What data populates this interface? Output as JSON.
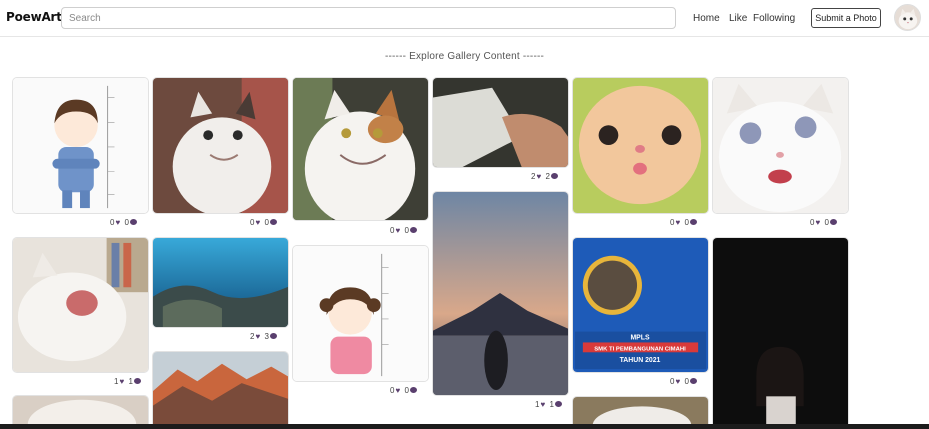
{
  "nav": {
    "brand": "PoewArt.",
    "search_placeholder": "Search",
    "links": {
      "home": "Home",
      "like": "Like",
      "following": "Following"
    },
    "submit_label": "Submit a Photo"
  },
  "gallery": {
    "title": "------ Explore Gallery Content ------",
    "items": [
      {
        "likes": "0",
        "comments": "0"
      },
      {
        "likes": "0",
        "comments": "0"
      },
      {
        "likes": "0",
        "comments": "0"
      },
      {
        "likes": "2",
        "comments": "2"
      },
      {
        "likes": "0",
        "comments": "0"
      },
      {
        "likes": "0",
        "comments": "0"
      },
      {
        "likes": "1",
        "comments": "1"
      },
      {
        "likes": "2",
        "comments": "3"
      },
      {
        "likes": "0",
        "comments": "0"
      },
      {
        "likes": "1",
        "comments": "1"
      },
      {
        "likes": "0",
        "comments": "0"
      }
    ],
    "banner": {
      "line1": "MPLS",
      "line2": "SMK TI PEMBANGUNAN CIMAHI",
      "line3": "TAHUN 2021"
    }
  },
  "icons": {
    "heart": "heart-icon",
    "comment": "comment-icon"
  },
  "colors": {
    "icon": "#5a3f6e",
    "border": "#e2e2e2",
    "banner_blue": "#1e5bb8"
  }
}
